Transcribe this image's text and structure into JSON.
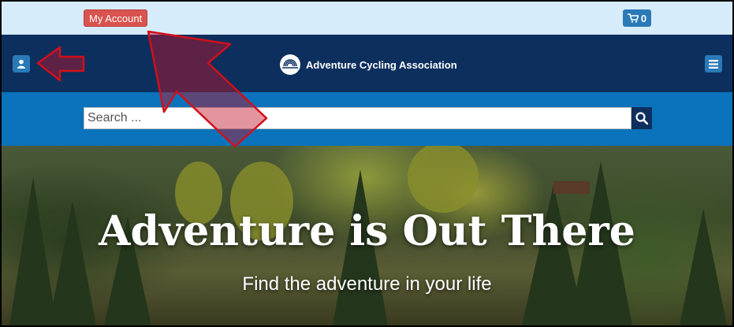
{
  "topbar": {
    "account_label": "My Account",
    "cart_count": "0"
  },
  "header": {
    "logo_text": "Adventure Cycling Association"
  },
  "search": {
    "placeholder": "Search ..."
  },
  "hero": {
    "title": "Adventure is Out There",
    "subtitle": "Find the adventure in your life"
  },
  "colors": {
    "topbar": "#d6ecfb",
    "navbar": "#0d2f5e",
    "searchbar": "#0a73bb",
    "account_button": "#d9534f",
    "button_blue": "#2a7ab8",
    "annotation_arrow": "#d0101c"
  },
  "icons": [
    "cart-icon",
    "user-icon",
    "hamburger-menu-icon",
    "search-icon",
    "logo-icon"
  ]
}
